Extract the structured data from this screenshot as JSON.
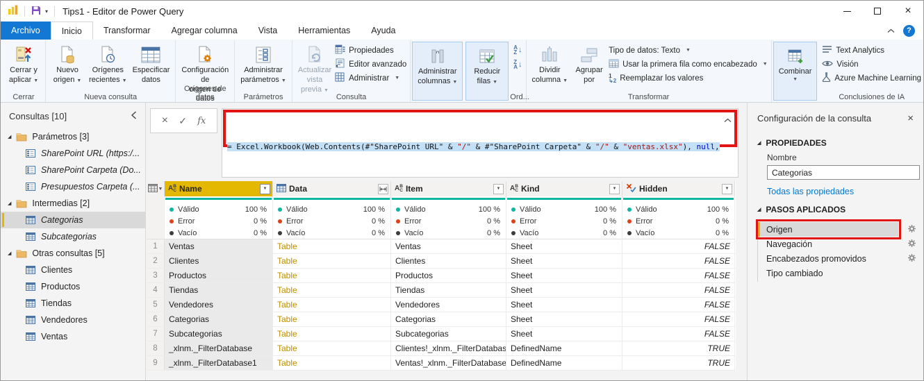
{
  "window": {
    "title": "Tips1 - Editor de Power Query"
  },
  "menu": {
    "tabs": [
      {
        "label": "Archivo"
      },
      {
        "label": "Inicio"
      },
      {
        "label": "Transformar"
      },
      {
        "label": "Agregar columna"
      },
      {
        "label": "Vista"
      },
      {
        "label": "Herramientas"
      },
      {
        "label": "Ayuda"
      }
    ]
  },
  "ribbon": {
    "group_labels": {
      "cerrar": "Cerrar",
      "nueva": "Nueva consulta",
      "origenes": "Orígenes de datos",
      "parametros": "Parámetros",
      "consulta": "Consulta",
      "ordenar": "Ord...",
      "transformar": "Transformar",
      "ia": "Conclusiones de IA"
    },
    "buttons": {
      "cerrar_aplicar": "Cerrar y\naplicar",
      "nuevo_origen": "Nuevo\norigen",
      "origenes_recientes": "Orígenes\nrecientes",
      "especificar_datos": "Especificar\ndatos",
      "config_origen": "Configuración de\norigen de datos",
      "admin_parametros": "Administrar\nparámetros",
      "actualizar": "Actualizar\nvista previa",
      "propiedades": "Propiedades",
      "editor_avanzado": "Editor avanzado",
      "administrar": "Administrar",
      "admin_columnas": "Administrar\ncolumnas",
      "reducir_filas": "Reducir\nfilas",
      "dividir_columna": "Dividir\ncolumna",
      "agrupar_por": "Agrupar\npor",
      "tipo_datos": "Tipo de datos: Texto",
      "primera_fila": "Usar la primera fila como encabezado",
      "reemplazar": "Reemplazar los valores",
      "combinar": "Combinar",
      "text_analytics": "Text Analytics",
      "vision": "Visión",
      "azure_ml": "Azure Machine Learning"
    }
  },
  "sidebar": {
    "header": "Consultas [10]",
    "items": [
      {
        "label": "Parámetros [3]",
        "kind": "folder"
      },
      {
        "label": "SharePoint URL (https:/...",
        "kind": "param",
        "italic": true
      },
      {
        "label": "SharePoint Carpeta (Do...",
        "kind": "param",
        "italic": true
      },
      {
        "label": "Presupuestos Carpeta (...",
        "kind": "param",
        "italic": true
      },
      {
        "label": "Intermedias [2]",
        "kind": "folder"
      },
      {
        "label": "Categorias",
        "kind": "table",
        "italic": true,
        "selected": true
      },
      {
        "label": "Subcategorias",
        "kind": "table",
        "italic": true
      },
      {
        "label": "Otras consultas [5]",
        "kind": "folder"
      },
      {
        "label": "Clientes",
        "kind": "table"
      },
      {
        "label": "Productos",
        "kind": "table"
      },
      {
        "label": "Tiendas",
        "kind": "table"
      },
      {
        "label": "Vendedores",
        "kind": "table"
      },
      {
        "label": "Ventas",
        "kind": "table"
      }
    ]
  },
  "formula": {
    "line1": [
      {
        "t": "= Excel.Workbook(Web.Contents(#\"SharePoint URL\" & ",
        "c": "code"
      },
      {
        "t": "\"/\"",
        "c": "string"
      },
      {
        "t": " & #\"SharePoint Carpeta\" & ",
        "c": "code"
      },
      {
        "t": "\"/\"",
        "c": "string"
      },
      {
        "t": " & ",
        "c": "code"
      },
      {
        "t": "\"ventas.xlsx\"",
        "c": "string"
      },
      {
        "t": "), ",
        "c": "code"
      },
      {
        "t": "null",
        "c": "keyword"
      },
      {
        "t": ",",
        "c": "code"
      }
    ],
    "line2": [
      {
        "t": "    ",
        "c": "code"
      },
      {
        "t": "true",
        "c": "keyword"
      },
      {
        "t": ")",
        "c": "code"
      }
    ]
  },
  "table": {
    "columns": [
      {
        "name": "Name",
        "type": "text",
        "selected": true
      },
      {
        "name": "Data",
        "type": "table",
        "expand": true
      },
      {
        "name": "Item",
        "type": "text"
      },
      {
        "name": "Kind",
        "type": "text"
      },
      {
        "name": "Hidden",
        "type": "logical"
      }
    ],
    "quality": {
      "valid_label": "Válido",
      "error_label": "Error",
      "empty_label": "Vacío",
      "valid": "100 %",
      "error": "0 %",
      "empty": "0 %"
    },
    "rows": [
      {
        "num": "1",
        "name": "Ventas",
        "data": "Table",
        "item": "Ventas",
        "kind": "Sheet",
        "hidden": "FALSE"
      },
      {
        "num": "2",
        "name": "Clientes",
        "data": "Table",
        "item": "Clientes",
        "kind": "Sheet",
        "hidden": "FALSE"
      },
      {
        "num": "3",
        "name": "Productos",
        "data": "Table",
        "item": "Productos",
        "kind": "Sheet",
        "hidden": "FALSE"
      },
      {
        "num": "4",
        "name": "Tiendas",
        "data": "Table",
        "item": "Tiendas",
        "kind": "Sheet",
        "hidden": "FALSE"
      },
      {
        "num": "5",
        "name": "Vendedores",
        "data": "Table",
        "item": "Vendedores",
        "kind": "Sheet",
        "hidden": "FALSE"
      },
      {
        "num": "6",
        "name": "Categorias",
        "data": "Table",
        "item": "Categorias",
        "kind": "Sheet",
        "hidden": "FALSE"
      },
      {
        "num": "7",
        "name": "Subcategorias",
        "data": "Table",
        "item": "Subcategorias",
        "kind": "Sheet",
        "hidden": "FALSE"
      },
      {
        "num": "8",
        "name": "_xlnm._FilterDatabase",
        "data": "Table",
        "item": "Clientes!_xlnm._FilterDatabase",
        "kind": "DefinedName",
        "hidden": "TRUE"
      },
      {
        "num": "9",
        "name": "_xlnm._FilterDatabase1",
        "data": "Table",
        "item": "Ventas!_xlnm._FilterDatabase",
        "kind": "DefinedName",
        "hidden": "TRUE"
      }
    ]
  },
  "right_panel": {
    "title": "Configuración de la consulta",
    "properties_header": "PROPIEDADES",
    "name_label": "Nombre",
    "name_value": "Categorias",
    "all_properties_link": "Todas las propiedades",
    "steps_header": "PASOS APLICADOS",
    "steps": [
      {
        "label": "Origen",
        "selected": true,
        "gear": true,
        "annotated": true
      },
      {
        "label": "Navegación",
        "gear": true
      },
      {
        "label": "Encabezados promovidos",
        "gear": true
      },
      {
        "label": "Tipo cambiado"
      }
    ]
  },
  "annotations": {
    "formula_box": "red-outline",
    "origin_step": "red-outline"
  },
  "colors": {
    "accent_blue": "#1377D4",
    "teal": "#10B5A2",
    "gold": "#E5B800",
    "table_link": "#BD8F00",
    "annotation_red": "#E21414",
    "error_red": "#E0401A",
    "link_blue": "#0078D4"
  }
}
